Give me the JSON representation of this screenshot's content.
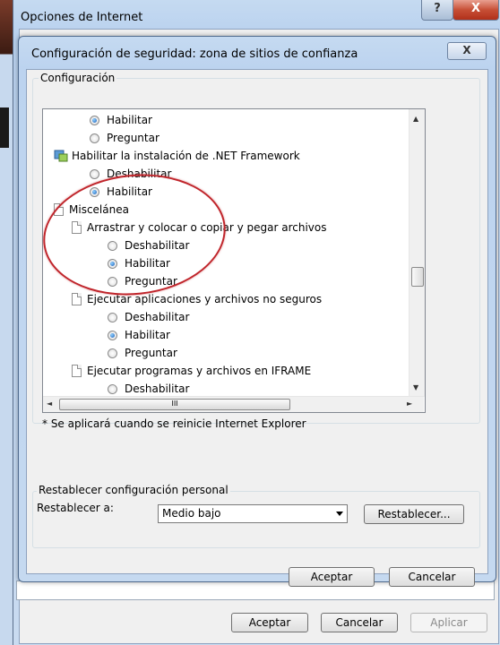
{
  "outer_window": {
    "title": "Opciones de Internet",
    "help_glyph": "?",
    "close_glyph": "X",
    "buttons": {
      "accept": "Aceptar",
      "cancel": "Cancelar",
      "apply": "Aplicar"
    }
  },
  "dialog": {
    "title": "Configuración de seguridad: zona de sitios de confianza",
    "close_glyph": "X",
    "settings_group_label": "Configuración",
    "tree_items": [
      {
        "type": "radio",
        "label": "Habilitar",
        "checked": true,
        "indent": 1
      },
      {
        "type": "radio",
        "label": "Preguntar",
        "checked": false,
        "indent": 1
      },
      {
        "type": "category",
        "icon": "net-framework-icon",
        "label": "Habilitar la instalación de .NET Framework",
        "indent": 0
      },
      {
        "type": "radio",
        "label": "Deshabilitar",
        "checked": false,
        "indent": 1
      },
      {
        "type": "radio",
        "label": "Habilitar",
        "checked": true,
        "indent": 1
      },
      {
        "type": "category",
        "icon": "page-icon",
        "label": "Miscelánea",
        "indent": 0
      },
      {
        "type": "category",
        "icon": "page-icon",
        "label": "Arrastrar y colocar o copiar y pegar archivos",
        "indent": 1
      },
      {
        "type": "radio",
        "label": "Deshabilitar",
        "checked": false,
        "indent": 2
      },
      {
        "type": "radio",
        "label": "Habilitar",
        "checked": true,
        "indent": 2
      },
      {
        "type": "radio",
        "label": "Preguntar",
        "checked": false,
        "indent": 2
      },
      {
        "type": "category",
        "icon": "page-icon",
        "label": "Ejecutar aplicaciones y archivos no seguros",
        "indent": 1
      },
      {
        "type": "radio",
        "label": "Deshabilitar",
        "checked": false,
        "indent": 2
      },
      {
        "type": "radio",
        "label": "Habilitar",
        "checked": true,
        "indent": 2
      },
      {
        "type": "radio",
        "label": "Preguntar",
        "checked": false,
        "indent": 2
      },
      {
        "type": "category",
        "icon": "page-icon",
        "label": "Ejecutar programas y archivos en IFRAME",
        "indent": 1
      },
      {
        "type": "radio",
        "label": "Deshabilitar",
        "checked": false,
        "indent": 2
      }
    ],
    "hscroll_thumb_glyph": "III",
    "note": "* Se aplicará cuando se reinicie Internet Explorer",
    "reset_group_label": "Restablecer configuración personal",
    "reset_label": "Restablecer a:",
    "reset_value": "Medio bajo",
    "reset_button": "Restablecer...",
    "accept_button": "Aceptar",
    "cancel_button": "Cancelar"
  },
  "colors": {
    "highlight_circle": "#c0252b",
    "radio_selected": "#1b5fb8",
    "title_bar": "#bcd3ef"
  }
}
